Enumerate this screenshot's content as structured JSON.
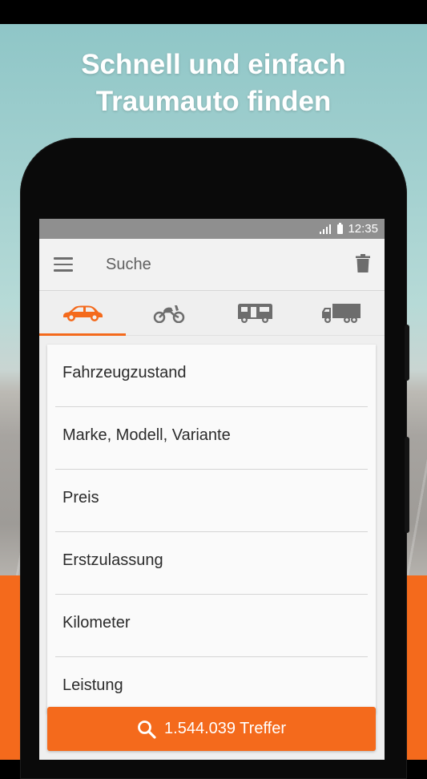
{
  "promo": {
    "headline_line1": "Schnell und einfach",
    "headline_line2": "Traumauto finden"
  },
  "status_bar": {
    "time": "12:35"
  },
  "app_bar": {
    "title": "Suche",
    "menu_icon": "menu-icon",
    "delete_icon": "trash-icon"
  },
  "vehicle_tabs": [
    {
      "icon": "car-icon",
      "active": true
    },
    {
      "icon": "motorcycle-icon",
      "active": false
    },
    {
      "icon": "camper-icon",
      "active": false
    },
    {
      "icon": "truck-icon",
      "active": false
    }
  ],
  "filters": [
    {
      "label": "Fahrzeugzustand"
    },
    {
      "label": "Marke, Modell, Variante"
    },
    {
      "label": "Preis"
    },
    {
      "label": "Erstzulassung"
    },
    {
      "label": "Kilometer"
    },
    {
      "label": "Leistung"
    }
  ],
  "search_button": {
    "label": "1.544.039 Treffer",
    "icon": "search-icon"
  },
  "colors": {
    "accent": "#f46a1c",
    "status_bar": "#8f8f8f",
    "icon_gray": "#6d6d6d"
  }
}
